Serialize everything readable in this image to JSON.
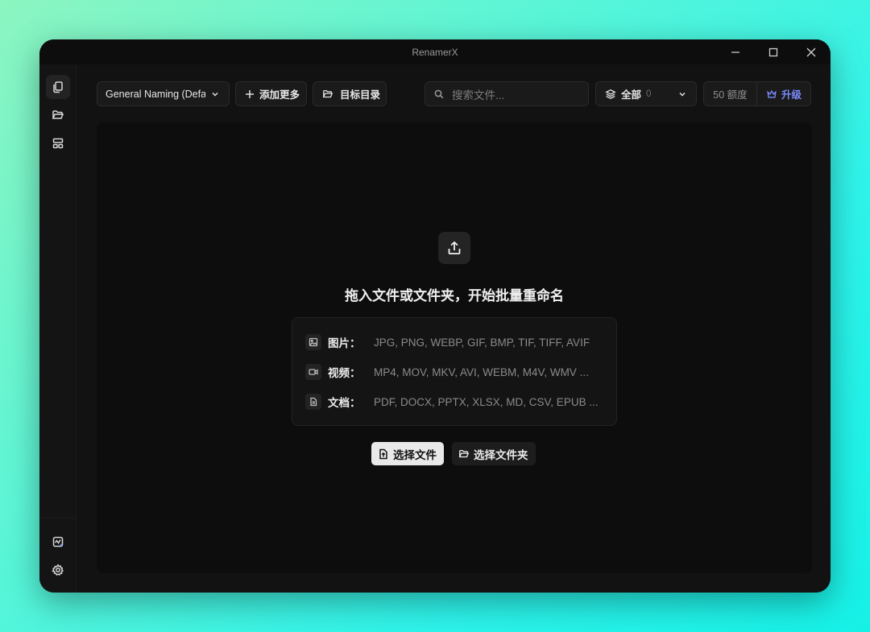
{
  "window": {
    "title": "RenamerX"
  },
  "toolbar": {
    "preset_label": "General Naming (Defa",
    "add_more_label": "添加更多",
    "target_dir_label": "目标目录",
    "search_placeholder": "搜索文件...",
    "filter_label": "全部",
    "filter_count": "0",
    "quota_label": "50 额度",
    "upgrade_label": "升级"
  },
  "dropzone": {
    "headline": "拖入文件或文件夹，开始批量重命名",
    "formats": [
      {
        "name": "图片：",
        "list": "JPG, PNG, WEBP, GIF, BMP, TIF, TIFF, AVIF",
        "icon": "image-icon"
      },
      {
        "name": "视频：",
        "list": "MP4, MOV, MKV, AVI, WEBM, M4V, WMV ...",
        "icon": "video-icon"
      },
      {
        "name": "文档：",
        "list": "PDF, DOCX, PPTX, XLSX, MD, CSV, EPUB ...",
        "icon": "document-icon"
      }
    ],
    "select_files_label": "选择文件",
    "select_folder_label": "选择文件夹"
  },
  "colors": {
    "accent_upgrade": "#7b8cff",
    "window_bg": "#121212",
    "dropzone_bg": "#0d0d0d"
  }
}
